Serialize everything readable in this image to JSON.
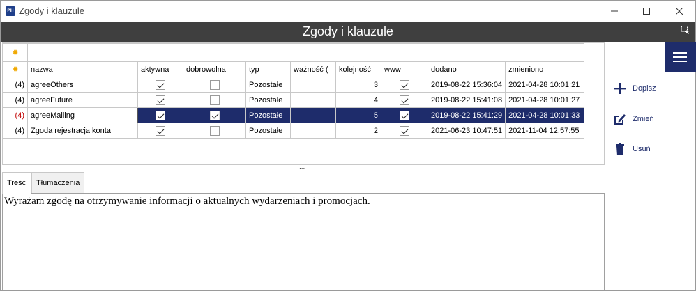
{
  "window": {
    "title": "Zgody i klauzule",
    "app_icon_text": "PH"
  },
  "header": {
    "title": "Zgody i klauzule"
  },
  "grid": {
    "columns": [
      "nazwa",
      "aktywna",
      "dobrowolna",
      "typ",
      "ważność (",
      "kolejność",
      "www",
      "dodano",
      "zmieniono"
    ],
    "rows": [
      {
        "marker": "(4)",
        "nazwa": "agreeOthers",
        "aktywna": true,
        "dobrowolna": false,
        "typ": "Pozostałe",
        "waznosc": "",
        "kolejnosc": "3",
        "www": true,
        "dodano": "2019-08-22 15:36:04",
        "zmieniono": "2021-04-28 10:01:21"
      },
      {
        "marker": "(4)",
        "nazwa": "agreeFuture",
        "aktywna": true,
        "dobrowolna": false,
        "typ": "Pozostałe",
        "waznosc": "",
        "kolejnosc": "4",
        "www": true,
        "dodano": "2019-08-22 15:41:08",
        "zmieniono": "2021-04-28 10:01:27"
      },
      {
        "marker": "(4)",
        "nazwa": "agreeMailing",
        "aktywna": true,
        "dobrowolna": true,
        "typ": "Pozostałe",
        "waznosc": "",
        "kolejnosc": "5",
        "www": true,
        "dodano": "2019-08-22 15:41:29",
        "zmieniono": "2021-04-28 10:01:33"
      },
      {
        "marker": "(4)",
        "nazwa": "Zgoda rejestracja konta",
        "aktywna": true,
        "dobrowolna": false,
        "typ": "Pozostałe",
        "waznosc": "",
        "kolejnosc": "2",
        "www": true,
        "dodano": "2021-06-23 10:47:51",
        "zmieniono": "2021-11-04 12:57:55"
      }
    ],
    "selected_row": 2
  },
  "splitter": "...",
  "tabs": [
    {
      "label": "Treść",
      "active": true
    },
    {
      "label": "Tłumaczenia",
      "active": false
    }
  ],
  "content": {
    "text": "Wyrażam zgodę na otrzymywanie informacji o aktualnych wydarzeniach i promocjach."
  },
  "actions": {
    "add": "Dopisz",
    "edit": "Zmień",
    "delete": "Usuń"
  },
  "colors": {
    "accent": "#1e2c6b",
    "header_bg": "#3f3f3f",
    "new_row_star": "#f0a800",
    "selected_marker": "#c00000"
  }
}
